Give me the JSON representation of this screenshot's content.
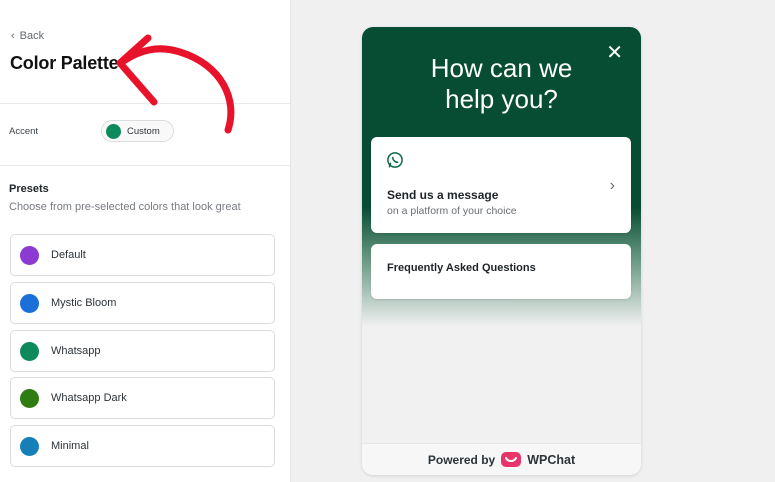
{
  "panel": {
    "back_label": "Back",
    "title": "Color Palette",
    "accent": {
      "label": "Accent",
      "value_label": "Custom",
      "color": "#0d8a5c"
    },
    "presets": {
      "heading": "Presets",
      "subtitle": "Choose from pre-selected colors that look great",
      "items": [
        {
          "label": "Default",
          "color": "#8b3bd1"
        },
        {
          "label": "Mystic Bloom",
          "color": "#1a6fd8"
        },
        {
          "label": "Whatsapp",
          "color": "#0d8a5c"
        },
        {
          "label": "Whatsapp Dark",
          "color": "#2f7d12"
        },
        {
          "label": "Minimal",
          "color": "#1580b8"
        }
      ]
    }
  },
  "widget": {
    "headline_line1": "How can we",
    "headline_line2": "help you?",
    "close_icon": "close-icon",
    "message_card": {
      "icon": "whatsapp-icon",
      "title": "Send us a message",
      "subtitle": "on a platform of your choice"
    },
    "faq_card": {
      "title": "Frequently Asked Questions"
    },
    "footer": {
      "powered_by": "Powered by",
      "brand": "WPChat"
    },
    "header_color": "#074d33"
  },
  "annotation_color": "#e8132a"
}
